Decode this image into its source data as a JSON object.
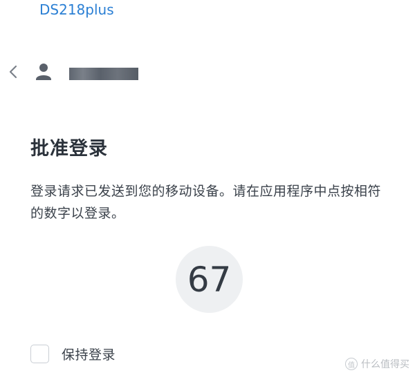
{
  "header": {
    "device_name": "DS218plus"
  },
  "account": {
    "back_icon": "chevron-left-icon",
    "user_icon": "user-icon"
  },
  "content": {
    "title": "批准登录",
    "description": "登录请求已发送到您的移动设备。请在应用程序中点按相符的数字以登录。",
    "number": "67"
  },
  "remember": {
    "label": "保持登录",
    "checked": false
  },
  "watermark": {
    "text": "什么值得买",
    "logo_glyph": "值"
  },
  "colors": {
    "accent": "#2a7fd4",
    "text": "#333a44",
    "circle_bg": "#eef0f2"
  }
}
